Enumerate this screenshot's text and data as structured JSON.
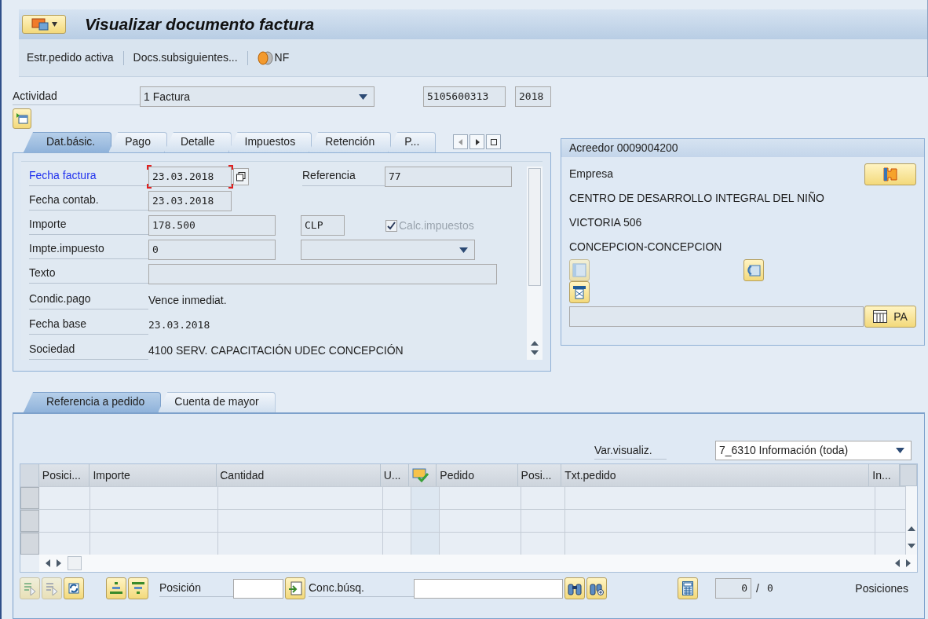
{
  "window": {
    "title": "Visualizar documento factura"
  },
  "toolbar": [
    {
      "label": "Estr.pedido activa",
      "kind": "text"
    },
    {
      "label": "Docs.subsiguientes...",
      "kind": "text"
    },
    {
      "label": "NF",
      "kind": "icon-text"
    }
  ],
  "header": {
    "activity_label": "Actividad",
    "activity_value": "1 Factura",
    "document_number": "5105600313",
    "year": "2018"
  },
  "tabs": [
    {
      "label": "Dat.básic.",
      "selected": true
    },
    {
      "label": "Pago",
      "selected": false
    },
    {
      "label": "Detalle",
      "selected": false
    },
    {
      "label": "Impuestos",
      "selected": false
    },
    {
      "label": "Retención",
      "selected": false
    },
    {
      "label": "P...",
      "selected": false
    }
  ],
  "basic_data": {
    "invoice_date": {
      "label": "Fecha factura",
      "value": "23.03.2018",
      "focused": true
    },
    "reference": {
      "label": "Referencia",
      "value": "77"
    },
    "posting_date": {
      "label": "Fecha contab.",
      "value": "23.03.2018"
    },
    "amount": {
      "label": "Importe",
      "value": "178.500",
      "currency": "CLP"
    },
    "calc_tax": {
      "label": "Calc.impuestos",
      "checked": true,
      "disabled": true
    },
    "tax_amount": {
      "label": "Impte.impuesto",
      "value": "0"
    },
    "text": {
      "label": "Texto"
    },
    "payment_terms": {
      "label": "Condic.pago",
      "value": "Vence inmediat."
    },
    "baseline_date": {
      "label": "Fecha base",
      "value": "23.03.2018"
    },
    "company": {
      "label": "Sociedad",
      "value": "4100 SERV. CAPACITACIÓN UDEC CONCEPCIÓN"
    }
  },
  "vendor": {
    "title": "Acreedor 0009004200",
    "lines": [
      "Empresa",
      "CENTRO DE DESARROLLO INTEGRAL DEL NIÑO",
      "VICTORIA 506",
      "CONCEPCION-CONCEPCION"
    ],
    "pa_button": "PA"
  },
  "lower_tabs": [
    {
      "label": "Referencia a pedido",
      "selected": true
    },
    {
      "label": "Cuenta de mayor",
      "selected": false
    }
  ],
  "layout_variant": {
    "label": "Var.visualiz.",
    "value": "7_6310 Información (toda)"
  },
  "table": {
    "columns": [
      {
        "label": "Posici...",
        "kind": "text"
      },
      {
        "label": "Importe",
        "kind": "text"
      },
      {
        "label": "Cantidad",
        "kind": "text"
      },
      {
        "label": "U...",
        "kind": "text"
      },
      {
        "kind": "icon"
      },
      {
        "label": "Pedido",
        "kind": "text"
      },
      {
        "label": "Posi...",
        "kind": "text"
      },
      {
        "label": "Txt.pedido",
        "kind": "text"
      },
      {
        "label": "In...",
        "kind": "text"
      }
    ]
  },
  "footer": {
    "position_label": "Posición",
    "search_label": "Conc.búsq.",
    "count_value": "0",
    "count_separator": "/",
    "count_total": "0",
    "count_label": "Posiciones"
  }
}
